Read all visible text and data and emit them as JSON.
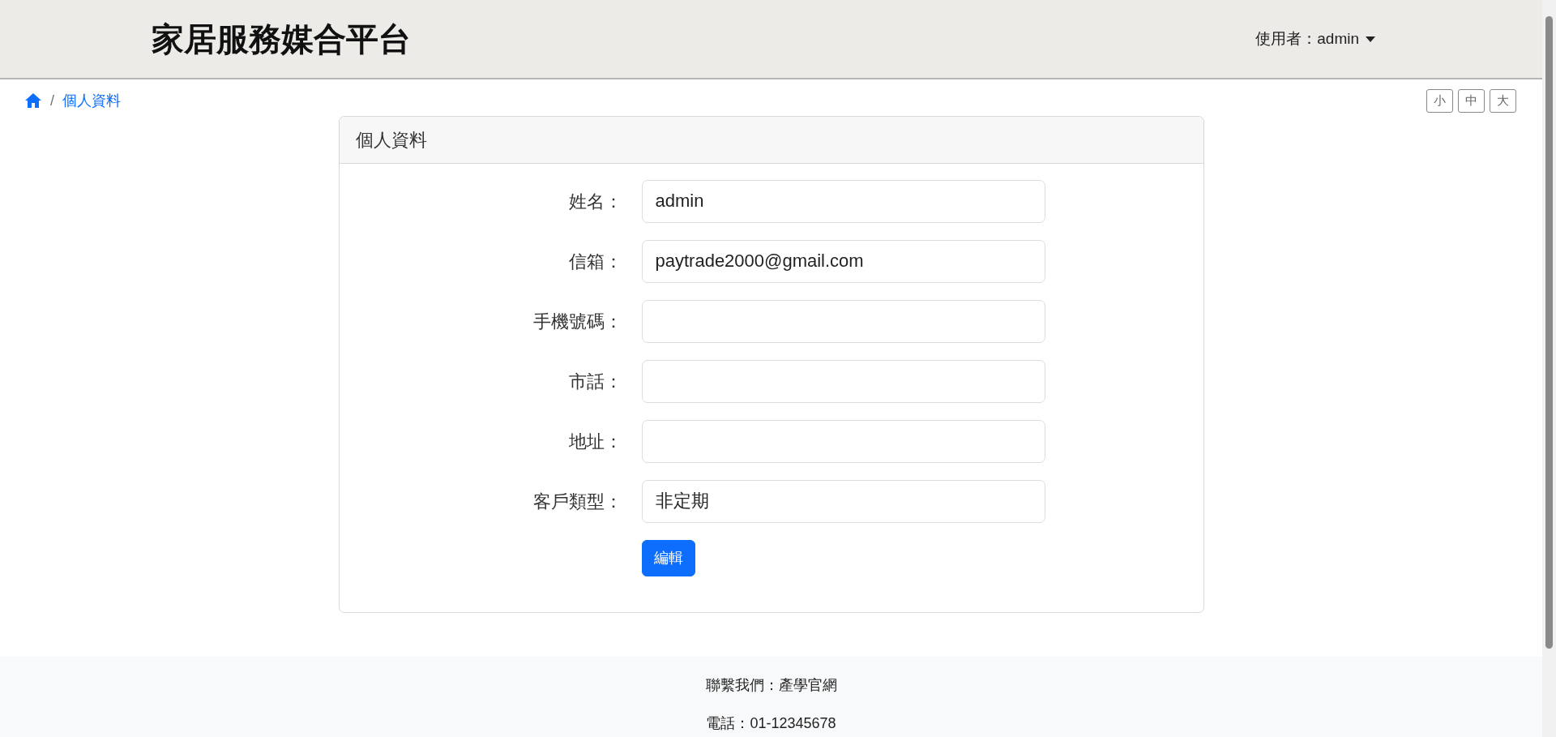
{
  "header": {
    "title": "家居服務媒合平台",
    "user_menu": "使用者：admin"
  },
  "breadcrumb": {
    "separator": "/",
    "current": "個人資料"
  },
  "font_size_buttons": [
    "小",
    "中",
    "大"
  ],
  "card": {
    "title": "個人資料",
    "fields": [
      {
        "label": "姓名：",
        "value": "admin"
      },
      {
        "label": "信箱：",
        "value": "paytrade2000@gmail.com"
      },
      {
        "label": "手機號碼："
      },
      {
        "label": "市話："
      },
      {
        "label": "地址："
      },
      {
        "label": "客戶類型：",
        "value": "非定期"
      }
    ],
    "button": "編輯"
  },
  "footer": {
    "contact": "聯繫我們：產學官網",
    "phone": "電話：01-12345678"
  }
}
